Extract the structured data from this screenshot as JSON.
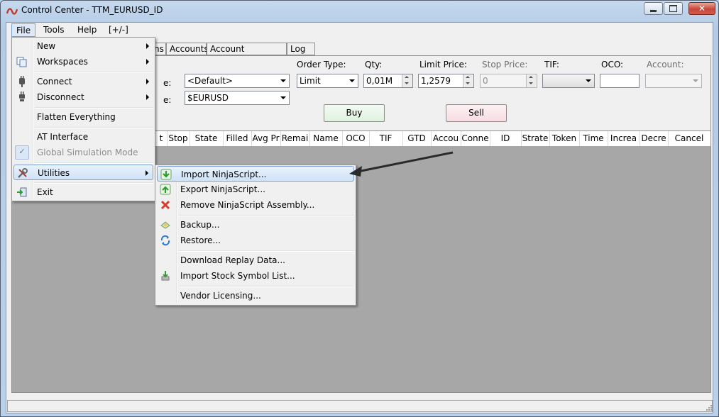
{
  "window": {
    "title": "Control Center - TTM_EURUSD_ID"
  },
  "menubar": {
    "items": [
      "File",
      "Tools",
      "Help",
      "[+/-]"
    ]
  },
  "tabs": [
    "ns",
    "Accounts",
    "Account Performance",
    "Log"
  ],
  "order_entry": {
    "partial_labels": [
      "e:",
      "e:"
    ],
    "strategy_value": "<Default>",
    "instrument_value": "$EURUSD",
    "order_type_label": "Order Type:",
    "order_type_value": "Limit",
    "qty_label": "Qty:",
    "qty_value": "0,01M",
    "limit_price_label": "Limit Price:",
    "limit_price_value": "1,2579",
    "stop_price_label": "Stop Price:",
    "stop_price_value": "0",
    "tif_label": "TIF:",
    "tif_value": "",
    "oco_label": "OCO:",
    "oco_value": "",
    "account_label": "Account:",
    "account_value": "",
    "buy_label": "Buy",
    "sell_label": "Sell"
  },
  "grid": {
    "columns": [
      "t",
      "Stop",
      "State",
      "Filled",
      "Avg Pr",
      "Remai",
      "Name",
      "OCO",
      "TIF",
      "GTD",
      "Accou",
      "Conne",
      "ID",
      "Strate",
      "Token",
      "Time",
      "Increa",
      "Decre",
      "Cancel"
    ]
  },
  "file_menu": {
    "items": [
      {
        "label": "New",
        "icon": "",
        "submenu": true,
        "disabled": false
      },
      {
        "label": "Workspaces",
        "icon": "workspaces-icon",
        "submenu": true,
        "disabled": false
      },
      {
        "label": "Connect",
        "icon": "connect-plug-icon",
        "submenu": true,
        "disabled": false
      },
      {
        "label": "Disconnect",
        "icon": "disconnect-plug-icon",
        "submenu": true,
        "disabled": false
      },
      {
        "label": "Flatten Everything",
        "icon": "",
        "submenu": false,
        "disabled": false
      },
      {
        "label": "AT Interface",
        "icon": "",
        "submenu": false,
        "disabled": false
      },
      {
        "label": "Global Simulation Mode",
        "icon": "check-icon",
        "submenu": false,
        "disabled": true
      },
      {
        "label": "Utilities",
        "icon": "tools-icon",
        "submenu": true,
        "disabled": false,
        "highlighted": true
      },
      {
        "label": "Exit",
        "icon": "exit-icon",
        "submenu": false,
        "disabled": false
      }
    ]
  },
  "utilities_menu": {
    "items": [
      {
        "label": "Import NinjaScript...",
        "icon": "import-arrow-icon",
        "highlighted": true
      },
      {
        "label": "Export NinjaScript...",
        "icon": "export-arrow-icon"
      },
      {
        "label": "Remove NinjaScript Assembly...",
        "icon": "remove-x-icon"
      },
      {
        "label": "Backup...",
        "icon": "backup-icon"
      },
      {
        "label": "Restore...",
        "icon": "restore-icon"
      },
      {
        "label": "Download Replay Data...",
        "icon": ""
      },
      {
        "label": "Import Stock Symbol List...",
        "icon": "import-list-icon"
      },
      {
        "label": "Vendor Licensing...",
        "icon": ""
      }
    ]
  },
  "colors": {
    "highlight_border": "#7da2ce",
    "buy_bg": "#eaf7ea",
    "sell_bg": "#fbe7ea",
    "grid_bg": "#a7a7a7",
    "annotation_arrow": "#2a2a2a"
  }
}
